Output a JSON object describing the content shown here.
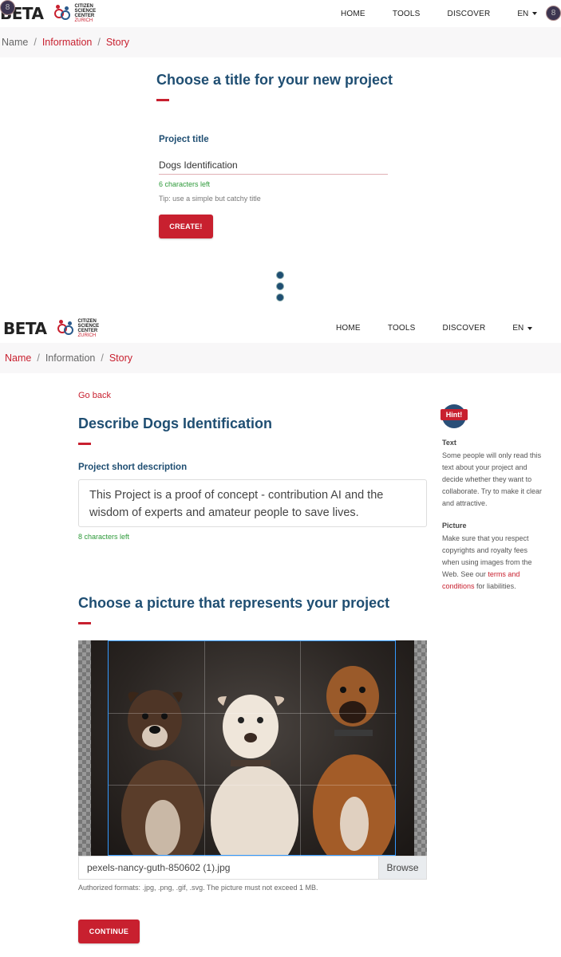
{
  "nav": {
    "brand": "BETA",
    "logo_lines": [
      "CITIZEN",
      "SCIENCE",
      "CENTER"
    ],
    "logo_city": "ZURICH",
    "links": [
      "HOME",
      "TOOLS",
      "DISCOVER"
    ],
    "language": "EN",
    "avatar_initial": "8"
  },
  "panel1": {
    "breadcrumb": [
      "Name",
      "Information",
      "Story"
    ],
    "heading": "Choose a title for your new project",
    "title_label": "Project title",
    "title_value": "Dogs Identification",
    "chars_left": "6 characters left",
    "tip": "Tip: use a simple but catchy title",
    "create_button": "CREATE!"
  },
  "panel2": {
    "breadcrumb": [
      "Name",
      "Information",
      "Story"
    ],
    "go_back": "Go back",
    "heading": "Describe Dogs Identification",
    "desc_label": "Project short description",
    "desc_value": "This Project is a proof of concept - contribution AI and the wisdom of experts and amateur people to save lives.",
    "desc_chars_left": "8 characters left",
    "hint": {
      "badge": "Hint!",
      "text_title": "Text",
      "text_body": "Some people will only read this text about your project and decide whether they want to collaborate. Try to make it clear and attractive.",
      "picture_title": "Picture",
      "picture_body": "Make sure that you respect copyrights and royalty fees when using images from the Web. See our",
      "terms_link": "terms and conditions",
      "picture_tail": "for liabilities."
    },
    "picture_heading": "Choose a picture that represents your project",
    "file_name": "pexels-nancy-guth-850602 (1).jpg",
    "browse": "Browse",
    "formats": "Authorized formats: .jpg, .png, .gif, .svg. The picture must not exceed 1 MB.",
    "continue_button": "CONTINUE"
  },
  "colors": {
    "brand_red": "#c8202f",
    "heading_blue": "#1f4e72",
    "success_green": "#2e9a3a"
  }
}
